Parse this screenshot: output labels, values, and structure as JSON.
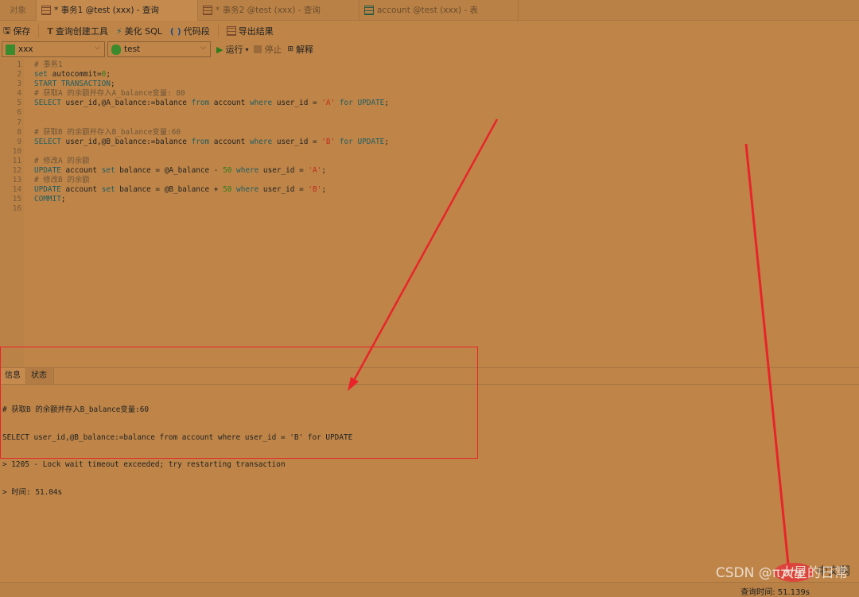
{
  "tabs": [
    {
      "label": "对象"
    },
    {
      "label": "* 事务1 @test (xxx) - 查询"
    },
    {
      "label": "* 事务2 @test (xxx) - 查询"
    },
    {
      "label": "account @test (xxx) - 表"
    }
  ],
  "toolbar": {
    "save": "保存",
    "query_builder": "查询创建工具",
    "beautify": "美化 SQL",
    "snippet": "代码段",
    "export": "导出结果"
  },
  "run_bar": {
    "connection": "xxx",
    "database": "test",
    "run": "运行",
    "stop": "停止",
    "explain": "解释"
  },
  "editor": {
    "lines": [
      [
        {
          "t": "# 事务1",
          "c": "cm"
        }
      ],
      [
        {
          "t": "set",
          "c": "kw"
        },
        {
          "t": " autocommit=",
          "c": "tx"
        },
        {
          "t": "0",
          "c": "nm"
        },
        {
          "t": ";",
          "c": "tx"
        }
      ],
      [
        {
          "t": "START TRANSACTION",
          "c": "kw"
        },
        {
          "t": ";",
          "c": "tx"
        }
      ],
      [
        {
          "t": "# 获取A 的余额并存入A_balance变量: 80",
          "c": "cm"
        }
      ],
      [
        {
          "t": "SELECT",
          "c": "kw"
        },
        {
          "t": " user_id,@A_balance:=balance ",
          "c": "tx"
        },
        {
          "t": "from",
          "c": "kw"
        },
        {
          "t": " account ",
          "c": "tx"
        },
        {
          "t": "where",
          "c": "kw"
        },
        {
          "t": " user_id = ",
          "c": "tx"
        },
        {
          "t": "'A'",
          "c": "st"
        },
        {
          "t": " ",
          "c": "tx"
        },
        {
          "t": "for UPDATE",
          "c": "kw"
        },
        {
          "t": ";",
          "c": "tx"
        }
      ],
      [],
      [],
      [
        {
          "t": "# 获取B 的余额并存入B_balance变量:60",
          "c": "cm"
        }
      ],
      [
        {
          "t": "SELECT",
          "c": "kw"
        },
        {
          "t": " user_id,@B_balance:=balance ",
          "c": "tx"
        },
        {
          "t": "from",
          "c": "kw"
        },
        {
          "t": " account ",
          "c": "tx"
        },
        {
          "t": "where",
          "c": "kw"
        },
        {
          "t": " user_id = ",
          "c": "tx"
        },
        {
          "t": "'B'",
          "c": "st"
        },
        {
          "t": " ",
          "c": "tx"
        },
        {
          "t": "for UPDATE",
          "c": "kw"
        },
        {
          "t": ";",
          "c": "tx"
        }
      ],
      [],
      [
        {
          "t": "# 修改A 的余额",
          "c": "cm"
        }
      ],
      [
        {
          "t": "UPDATE",
          "c": "kw"
        },
        {
          "t": " account ",
          "c": "tx"
        },
        {
          "t": "set",
          "c": "kw"
        },
        {
          "t": " balance = @A_balance - ",
          "c": "tx"
        },
        {
          "t": "50",
          "c": "nm"
        },
        {
          "t": " ",
          "c": "tx"
        },
        {
          "t": "where",
          "c": "kw"
        },
        {
          "t": " user_id = ",
          "c": "tx"
        },
        {
          "t": "'A'",
          "c": "st"
        },
        {
          "t": ";",
          "c": "tx"
        }
      ],
      [
        {
          "t": "# 修改B 的余额",
          "c": "cm"
        }
      ],
      [
        {
          "t": "UPDATE",
          "c": "kw"
        },
        {
          "t": " account ",
          "c": "tx"
        },
        {
          "t": "set",
          "c": "kw"
        },
        {
          "t": " balance = @B_balance + ",
          "c": "tx"
        },
        {
          "t": "50",
          "c": "nm"
        },
        {
          "t": " ",
          "c": "tx"
        },
        {
          "t": "where",
          "c": "kw"
        },
        {
          "t": " user_id = ",
          "c": "tx"
        },
        {
          "t": "'B'",
          "c": "st"
        },
        {
          "t": ";",
          "c": "tx"
        }
      ],
      [
        {
          "t": "COMMIT",
          "c": "kw"
        },
        {
          "t": ";",
          "c": "tx"
        }
      ],
      []
    ]
  },
  "result_panel": {
    "tabs": [
      "信息",
      "状态"
    ],
    "messages": [
      "# 获取B 的余额并存入B_balance变量:60",
      "SELECT user_id,@B_balance:=balance from account where user_id = 'B' for UPDATE",
      "> 1205 - Lock wait timeout exceeded; try restarting transaction",
      "> 时间: 51.04s"
    ]
  },
  "status": {
    "query_time": "查询时间: 51.139s"
  },
  "watermark": {
    "csdn": "CSDN @π大星的日常",
    "php": "php",
    "php_cn": "中文网"
  },
  "colors": {
    "background": "#bf8548",
    "annotation": "#e8242a"
  }
}
